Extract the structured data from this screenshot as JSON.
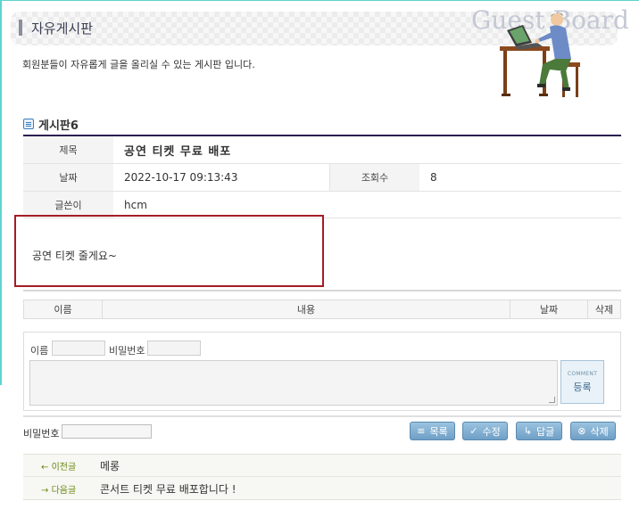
{
  "header": {
    "title": "자유게시판",
    "brand_text": "Guest Board",
    "description": "회원분들이 자유롭게 글을 올리실 수 있는 게시판 입니다."
  },
  "board": {
    "name": "게시판6"
  },
  "post": {
    "title_label": "제목",
    "title": "공연 티켓 무료 배포",
    "date_label": "날짜",
    "date": "2022-10-17 09:13:43",
    "views_label": "조회수",
    "views": "8",
    "author_label": "글쓴이",
    "author": "hcm",
    "body": "공연 티켓 줄게요~"
  },
  "comments": {
    "columns": [
      "이름",
      "내용",
      "날짜",
      "삭제"
    ],
    "form": {
      "name_label": "이름",
      "password_label": "비밀번호",
      "submit_small": "COMMENT",
      "submit_label": "등록"
    }
  },
  "actions": {
    "password_label": "비밀번호",
    "list": "목록",
    "edit": "수정",
    "reply": "답글",
    "delete": "삭제"
  },
  "navigation": {
    "prev_label": "이전글",
    "prev_title": "메롱",
    "next_label": "다음글",
    "next_title": "콘서트 티켓 무료 배포합니다 !"
  },
  "colors": {
    "accent_border": "#2a1f4f",
    "highlight_box": "#a51c24",
    "button": "#7aa7cc",
    "nav_label": "#6a8a10"
  }
}
